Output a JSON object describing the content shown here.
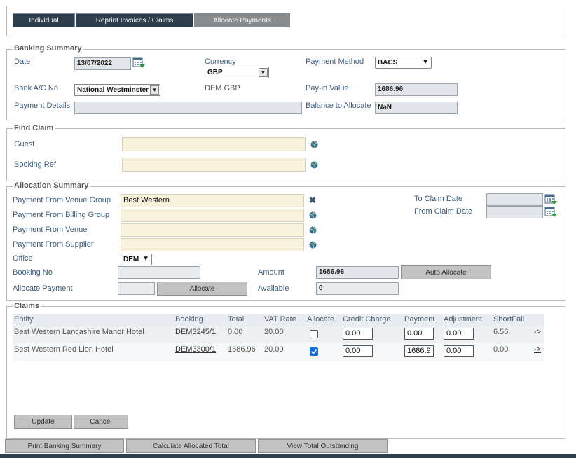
{
  "tabs": [
    {
      "label": "Individual",
      "active": false
    },
    {
      "label": "Reprint Invoices / Claims",
      "active": false
    },
    {
      "label": "Allocate Payments",
      "active": true
    }
  ],
  "banking": {
    "legend": "Banking Summary",
    "date_label": "Date",
    "date_value": "13/07/2022",
    "currency_label": "Currency",
    "currency_value": "GBP",
    "payment_method_label": "Payment Method",
    "payment_method_value": "BACS",
    "bank_label": "Bank A/C No",
    "bank_value": "National Westminster",
    "bank_currency_text": "DEM GBP",
    "payin_label": "Pay-in Value",
    "payin_value": "1686.96",
    "details_label": "Payment Details",
    "details_value": "",
    "balance_label": "Balance to Allocate",
    "balance_value": "NaN"
  },
  "find_claim": {
    "legend": "Find Claim",
    "guest_label": "Guest",
    "guest_value": "",
    "booking_ref_label": "Booking Ref",
    "booking_ref_value": ""
  },
  "allocation": {
    "legend": "Allocation Summary",
    "venue_group_label": "Payment From Venue Group",
    "venue_group_value": "Best Western",
    "billing_group_label": "Payment From Billing Group",
    "billing_group_value": "",
    "venue_label": "Payment From Venue",
    "venue_value": "",
    "supplier_label": "Payment From Supplier",
    "supplier_value": "",
    "office_label": "Office",
    "office_value": "DEM",
    "booking_no_label": "Booking No",
    "booking_no_value": "",
    "allocate_payment_label": "Allocate Payment",
    "allocate_payment_value": "",
    "allocate_button": "Allocate",
    "to_claim_label": "To Claim Date",
    "to_claim_value": "",
    "from_claim_label": "From Claim Date",
    "from_claim_value": "",
    "amount_label": "Amount",
    "amount_value": "1686.96",
    "auto_allocate_button": "Auto Allocate",
    "available_label": "Available",
    "available_value": "0"
  },
  "claims": {
    "legend": "Claims",
    "columns": [
      "Entity",
      "Booking",
      "Total",
      "VAT Rate",
      "Allocate",
      "Credit Charge",
      "Payment",
      "Adjustment",
      "ShortFall"
    ],
    "rows": [
      {
        "entity": "Best Western Lancashire Manor Hotel",
        "booking": "DEM3245/1",
        "total": "0.00",
        "vat": "20.00",
        "allocate": false,
        "credit": "0.00",
        "payment": "0.00",
        "adjustment": "0.00",
        "shortfall": "6.56",
        "link": "->"
      },
      {
        "entity": "Best Western Red Lion Hotel",
        "booking": "DEM3300/1",
        "total": "1686.96",
        "vat": "20.00",
        "allocate": true,
        "credit": "0.00",
        "payment": "1686.9",
        "adjustment": "0.00",
        "shortfall": "0.00",
        "link": "->"
      }
    ],
    "update_button": "Update",
    "cancel_button": "Cancel"
  },
  "footer": {
    "print_button": "Print Banking Summary",
    "calc_button": "Calculate Allocated Total",
    "view_button": "View Total Outstanding"
  },
  "colors": {
    "tab_dark": "#2e3e4d",
    "tab_active": "#888c8f",
    "label_blue": "#3b5b7a",
    "cream_input": "#f8f1db",
    "grey_input": "#e2e6ea",
    "checkbox_blue": "#0f6fd6"
  }
}
